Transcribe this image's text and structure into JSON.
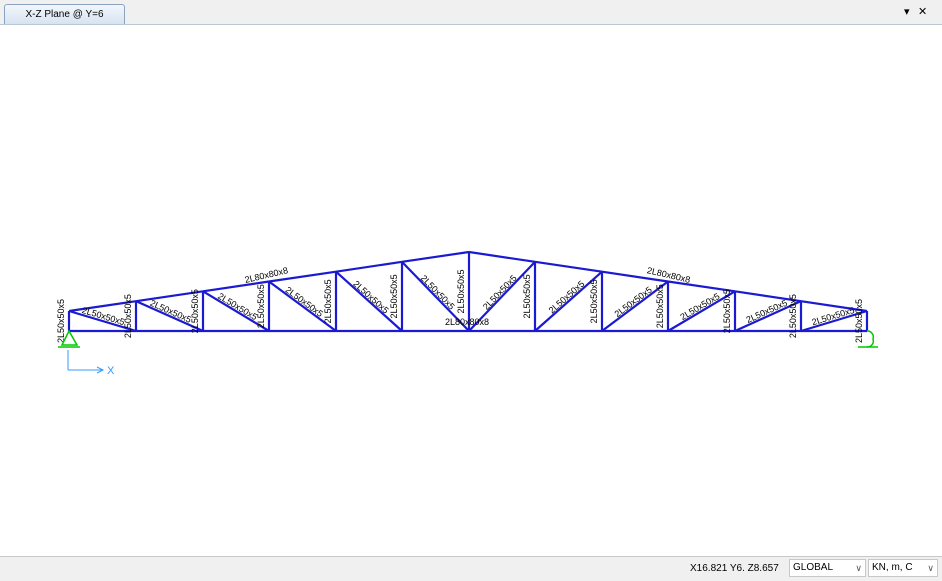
{
  "window": {
    "tab_title": "X-Z Plane @ Y=6",
    "dropdown_glyph": "▾",
    "close_glyph": "✕"
  },
  "diagram": {
    "colors": {
      "members": "#1a1ad2",
      "support": "#00c800",
      "axis": "#3399ff"
    },
    "axis_label": "X",
    "members": {
      "top_chord": "2L80x80x8",
      "bottom_chord": "2L80x80x8",
      "verticals": [
        "2L50x50x5",
        "2L50x50x5",
        "2L50x50x5",
        "2L50x50x5",
        "2L50x50x5",
        "2L50x50x5",
        "2L50x50x5",
        "2L50x50x5",
        "2L50x50x5",
        "2L50x50x5",
        "2L50x50x5",
        "2L50x50x5",
        "2L50x50x5"
      ],
      "diagonals": [
        "2L50x50x5",
        "2L50x50x5",
        "2L50x50x5",
        "2L50x50x5",
        "2L50x50x5",
        "2L50x50x5",
        "2L50x50x5",
        "2L50x50x5",
        "2L50x50x5",
        "2L50x50x5",
        "2L50x50x5",
        "2L50x50x5"
      ]
    }
  },
  "status": {
    "coordinates": "X16.821  Y6.  Z8.657",
    "coord_system": "GLOBAL",
    "units": "KN, m, C"
  }
}
